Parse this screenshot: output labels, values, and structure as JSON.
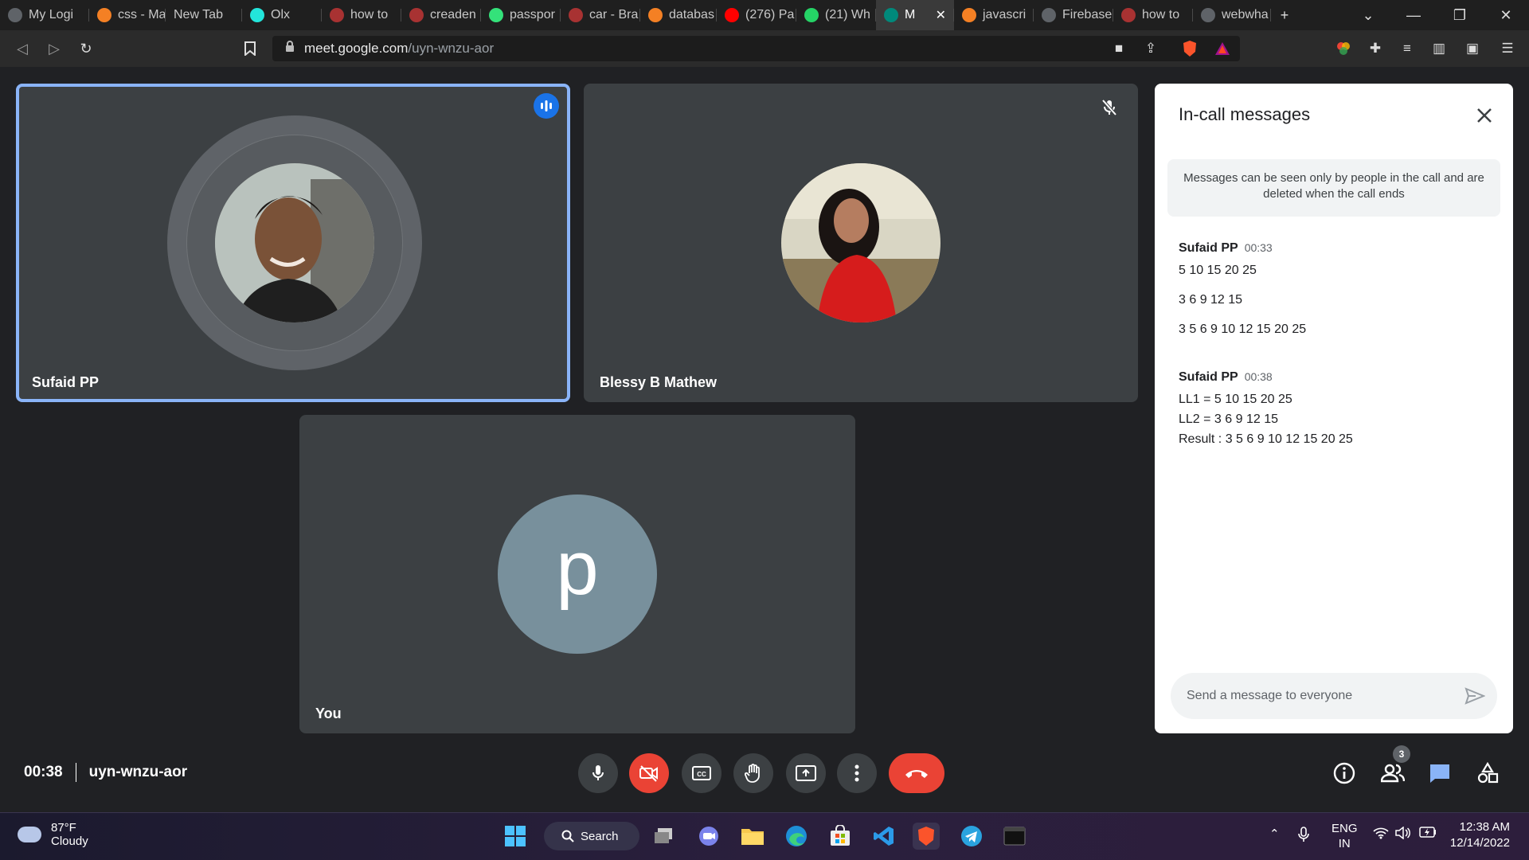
{
  "browser": {
    "tabs": [
      {
        "label": "My Logi",
        "icon": "globe-icon",
        "color": "#5f6368"
      },
      {
        "label": "css - Ma",
        "icon": "stackoverflow-icon",
        "color": "#f48024"
      },
      {
        "label": "New Tab",
        "icon": "",
        "color": ""
      },
      {
        "label": "Olx",
        "icon": "olx-icon",
        "color": "#23e5db"
      },
      {
        "label": "how to",
        "icon": "brave-search-icon",
        "color": "#a83232"
      },
      {
        "label": "creaden",
        "icon": "brave-search-icon",
        "color": "#a83232"
      },
      {
        "label": "passpor",
        "icon": "passport-icon",
        "color": "#34e27a"
      },
      {
        "label": "car - Bra",
        "icon": "brave-search-icon",
        "color": "#a83232"
      },
      {
        "label": "databas",
        "icon": "stackoverflow-icon",
        "color": "#f48024"
      },
      {
        "label": "(276) Pa",
        "icon": "youtube-icon",
        "color": "#ff0000"
      },
      {
        "label": "(21) Wh",
        "icon": "whatsapp-icon",
        "color": "#25d366"
      },
      {
        "label": "M",
        "icon": "meet-icon",
        "color": "#00897b",
        "active": true
      },
      {
        "label": "javascri",
        "icon": "stackoverflow-icon",
        "color": "#f48024"
      },
      {
        "label": "Firebase",
        "icon": "globe-icon",
        "color": "#5f6368"
      },
      {
        "label": "how to",
        "icon": "brave-search-icon",
        "color": "#a83232"
      },
      {
        "label": "webwha",
        "icon": "globe-icon",
        "color": "#5f6368"
      }
    ],
    "url_host": "meet.google.com",
    "url_path": "/uyn-wnzu-aor"
  },
  "participants": [
    {
      "name": "Sufaid PP",
      "speaking": true
    },
    {
      "name": "Blessy B Mathew",
      "muted": true
    },
    {
      "name": "You",
      "initial": "p"
    }
  ],
  "chat": {
    "title": "In-call messages",
    "notice": "Messages can be seen only by people in the call and are deleted when the call ends",
    "messages": [
      {
        "sender": "Sufaid PP",
        "time": "00:33",
        "lines": [
          "5 10 15 20 25",
          "3 6 9 12 15",
          "3 5 6 9 10 12 15 20 25"
        ]
      },
      {
        "sender": "Sufaid PP",
        "time": "00:38",
        "lines": [
          "LL1 = 5 10 15 20 25",
          "LL2 = 3 6 9 12 15",
          "Result : 3 5 6 9 10 12 15 20 25"
        ]
      }
    ],
    "input_placeholder": "Send a message to everyone"
  },
  "meeting": {
    "elapsed": "00:38",
    "code": "uyn-wnzu-aor",
    "people_count": "3"
  },
  "taskbar": {
    "weather_temp": "87°F",
    "weather_desc": "Cloudy",
    "search_label": "Search",
    "lang_top": "ENG",
    "lang_bottom": "IN",
    "time": "12:38 AM",
    "date": "12/14/2022"
  }
}
